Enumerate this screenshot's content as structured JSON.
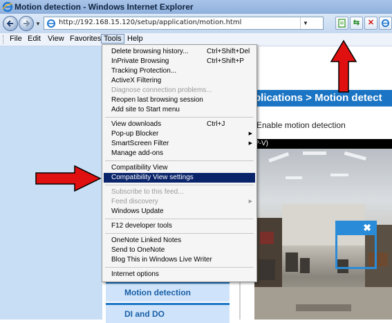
{
  "window": {
    "title": "Motion detection - Windows Internet Explorer"
  },
  "address": {
    "url": "http://192.168.15.120/setup/application/motion.html"
  },
  "menubar": {
    "items": [
      "File",
      "Edit",
      "View",
      "Favorites",
      "Tools",
      "Help"
    ]
  },
  "tools_menu": [
    {
      "label": "Delete browsing history...",
      "shortcut": "Ctrl+Shift+Del"
    },
    {
      "label": "InPrivate Browsing",
      "shortcut": "Ctrl+Shift+P"
    },
    {
      "label": "Tracking Protection..."
    },
    {
      "label": "ActiveX Filtering"
    },
    {
      "label": "Diagnose connection problems...",
      "disabled": true
    },
    {
      "label": "Reopen last browsing session"
    },
    {
      "label": "Add site to Start menu"
    },
    {
      "label": "View downloads",
      "shortcut": "Ctrl+J"
    },
    {
      "label": "Pop-up Blocker",
      "submenu": true
    },
    {
      "label": "SmartScreen Filter",
      "submenu": true
    },
    {
      "label": "Manage add-ons"
    },
    {
      "label": "Compatibility View"
    },
    {
      "label": "Compatibility View settings",
      "highlighted": true
    },
    {
      "label": "Subscribe to this feed...",
      "disabled": true
    },
    {
      "label": "Feed discovery",
      "disabled": true,
      "submenu": true
    },
    {
      "label": "Windows Update"
    },
    {
      "label": "F12 developer tools"
    },
    {
      "label": "OneNote Linked Notes"
    },
    {
      "label": "Send to OneNote"
    },
    {
      "label": "Blog This in Windows Live Writer"
    },
    {
      "label": "Internet options"
    }
  ],
  "page": {
    "breadcrumb": "plications  > Motion detect",
    "enable_label": "Enable motion detection",
    "video_header": "P-V)",
    "side_menu": [
      "Motion detection",
      "DI and DO"
    ]
  },
  "colors": {
    "accent": "#1b75c4",
    "highlight": "#0a246a",
    "arrow": "#e01010"
  }
}
